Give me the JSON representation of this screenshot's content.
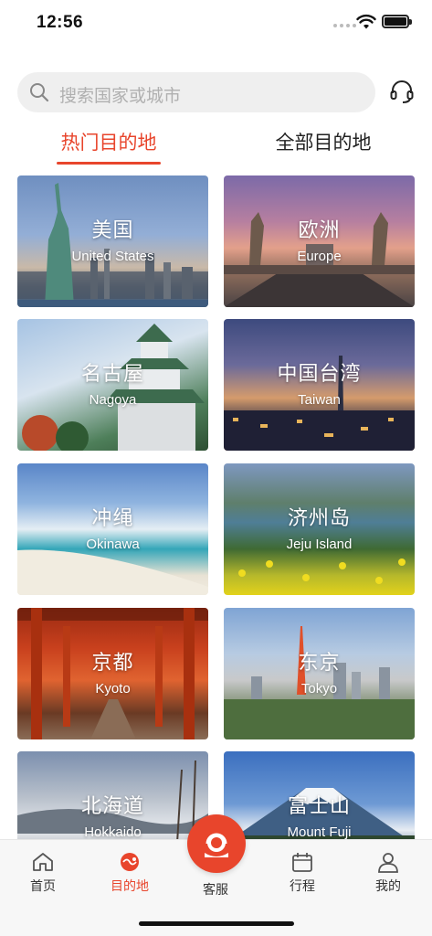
{
  "status_bar": {
    "time": "12:56"
  },
  "search": {
    "placeholder": "搜索国家或城市"
  },
  "tabs": [
    {
      "label": "热门目的地",
      "active": true
    },
    {
      "label": "全部目的地",
      "active": false
    }
  ],
  "destinations": [
    {
      "zh": "美国",
      "en": "United States"
    },
    {
      "zh": "欧洲",
      "en": "Europe"
    },
    {
      "zh": "名古屋",
      "en": "Nagoya"
    },
    {
      "zh": "中国台湾",
      "en": "Taiwan"
    },
    {
      "zh": "冲绳",
      "en": "Okinawa"
    },
    {
      "zh": "济州岛",
      "en": "Jeju Island"
    },
    {
      "zh": "京都",
      "en": "Kyoto"
    },
    {
      "zh": "东京",
      "en": "Tokyo"
    },
    {
      "zh": "北海道",
      "en": "Hokkaido"
    },
    {
      "zh": "富士山",
      "en": "Mount Fuji"
    }
  ],
  "bottom_nav": [
    {
      "label": "首页",
      "icon": "home-icon"
    },
    {
      "label": "目的地",
      "icon": "destination-icon",
      "active": true
    },
    {
      "label": "客服",
      "icon": "customer-service-icon"
    },
    {
      "label": "行程",
      "icon": "calendar-icon"
    },
    {
      "label": "我的",
      "icon": "profile-icon"
    }
  ],
  "colors": {
    "accent": "#e8452c",
    "search_bg": "#efefef"
  }
}
